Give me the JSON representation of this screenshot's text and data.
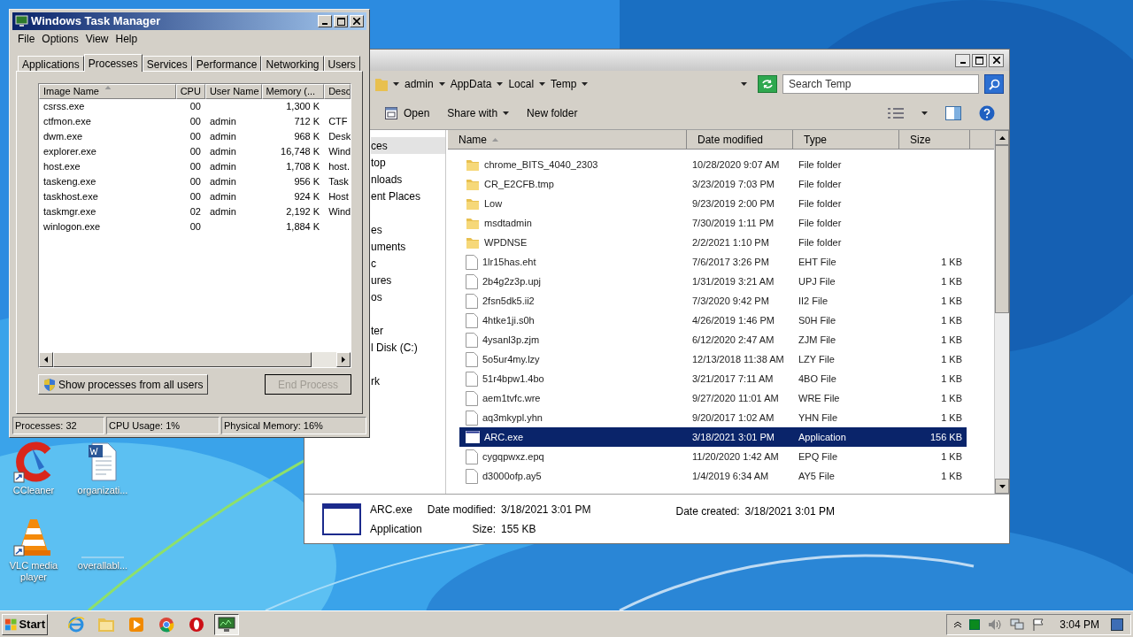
{
  "desktop": {
    "icons": [
      {
        "label": "CCleaner",
        "kind": "ccleaner"
      },
      {
        "label": "organizati...",
        "kind": "word"
      },
      {
        "label": "VLC media player",
        "kind": "vlc"
      },
      {
        "label": "overallabl...",
        "kind": "blank"
      }
    ]
  },
  "task_manager": {
    "title": "Windows Task Manager",
    "menu": [
      "File",
      "Options",
      "View",
      "Help"
    ],
    "tabs": [
      {
        "label": "Applications",
        "selected": false
      },
      {
        "label": "Processes",
        "selected": true
      },
      {
        "label": "Services",
        "selected": false
      },
      {
        "label": "Performance",
        "selected": false
      },
      {
        "label": "Networking",
        "selected": false
      },
      {
        "label": "Users",
        "selected": false
      }
    ],
    "columns": [
      {
        "label": "Image Name",
        "sorted": true
      },
      {
        "label": "CPU",
        "sorted": false
      },
      {
        "label": "User Name",
        "sorted": false
      },
      {
        "label": "Memory (...",
        "sorted": false
      },
      {
        "label": "Desc",
        "sorted": false
      }
    ],
    "rows": [
      {
        "name": "csrss.exe",
        "cpu": "00",
        "memory": "1,300 K"
      },
      {
        "name": "ctfmon.exe",
        "cpu": "00",
        "user": "admin",
        "memory": "712 K",
        "desc": "CTF"
      },
      {
        "name": "dwm.exe",
        "cpu": "00",
        "user": "admin",
        "memory": "968 K",
        "desc": "Desk"
      },
      {
        "name": "explorer.exe",
        "cpu": "00",
        "user": "admin",
        "memory": "16,748 K",
        "desc": "Wind"
      },
      {
        "name": "host.exe",
        "cpu": "00",
        "user": "admin",
        "memory": "1,708 K",
        "desc": "host."
      },
      {
        "name": "taskeng.exe",
        "cpu": "00",
        "user": "admin",
        "memory": "956 K",
        "desc": "Task"
      },
      {
        "name": "taskhost.exe",
        "cpu": "00",
        "user": "admin",
        "memory": "924 K",
        "desc": "Host"
      },
      {
        "name": "taskmgr.exe",
        "cpu": "02",
        "user": "admin",
        "memory": "2,192 K",
        "desc": "Wind"
      },
      {
        "name": "winlogon.exe",
        "cpu": "00",
        "memory": "1,884 K"
      }
    ],
    "show_all_button": {
      "label": "Show processes from all users"
    },
    "end_button": {
      "label": "End Process",
      "disabled": true
    },
    "status": [
      "Processes: 32",
      "CPU Usage: 1%",
      "Physical Memory: 16%"
    ]
  },
  "explorer": {
    "breadcrumb": [
      "admin",
      "AppData",
      "Local",
      "Temp"
    ],
    "search": {
      "placeholder": "Search Temp"
    },
    "toolbar": [
      {
        "label": "Open",
        "kind": "icon"
      },
      {
        "label": "Share with",
        "kind": "menu"
      },
      {
        "label": "New folder",
        "kind": "plain"
      }
    ],
    "nav_groups": [
      {
        "items": [
          {
            "label": "ces",
            "selected": true
          },
          {
            "label": "top",
            "selected": false
          },
          {
            "label": "nloads",
            "selected": false
          },
          {
            "label": "ent Places",
            "selected": false
          }
        ]
      },
      {
        "items": [
          {
            "label": "es",
            "selected": false
          },
          {
            "label": "uments",
            "selected": false
          },
          {
            "label": "c",
            "selected": false
          },
          {
            "label": "ures",
            "selected": false
          },
          {
            "label": "os",
            "selected": false
          }
        ]
      },
      {
        "items": [
          {
            "label": "ter",
            "selected": false
          },
          {
            "label": "l Disk (C:)",
            "selected": false
          }
        ]
      },
      {
        "items": [
          {
            "label": "rk",
            "selected": false
          }
        ]
      }
    ],
    "columns": [
      {
        "label": "Name",
        "sorted": true
      },
      {
        "label": "Date modified",
        "sorted": false
      },
      {
        "label": "Type",
        "sorted": false
      },
      {
        "label": "Size",
        "sorted": false
      }
    ],
    "files": [
      {
        "name": "chrome_BITS_4040_2303",
        "date": "10/28/2020 9:07 AM",
        "type": "File folder",
        "kind": "folder",
        "selected": false
      },
      {
        "name": "CR_E2CFB.tmp",
        "date": "3/23/2019 7:03 PM",
        "type": "File folder",
        "kind": "folder",
        "selected": false
      },
      {
        "name": "Low",
        "date": "9/23/2019 2:00 PM",
        "type": "File folder",
        "kind": "folder",
        "selected": false
      },
      {
        "name": "msdtadmin",
        "date": "7/30/2019 1:11 PM",
        "type": "File folder",
        "kind": "folder",
        "selected": false
      },
      {
        "name": "WPDNSE",
        "date": "2/2/2021 1:10 PM",
        "type": "File folder",
        "kind": "folder",
        "selected": false
      },
      {
        "name": "1lr15has.eht",
        "date": "7/6/2017 3:26 PM",
        "type": "EHT File",
        "size": "1 KB",
        "kind": "file",
        "selected": false
      },
      {
        "name": "2b4g2z3p.upj",
        "date": "1/31/2019 3:21 AM",
        "type": "UPJ File",
        "size": "1 KB",
        "kind": "file",
        "selected": false
      },
      {
        "name": "2fsn5dk5.ii2",
        "date": "7/3/2020 9:42 PM",
        "type": "II2 File",
        "size": "1 KB",
        "kind": "file",
        "selected": false
      },
      {
        "name": "4htke1ji.s0h",
        "date": "4/26/2019 1:46 PM",
        "type": "S0H File",
        "size": "1 KB",
        "kind": "file",
        "selected": false
      },
      {
        "name": "4ysanl3p.zjm",
        "date": "6/12/2020 2:47 AM",
        "type": "ZJM File",
        "size": "1 KB",
        "kind": "file",
        "selected": false
      },
      {
        "name": "5o5ur4my.lzy",
        "date": "12/13/2018 11:38 AM",
        "type": "LZY File",
        "size": "1 KB",
        "kind": "file",
        "selected": false
      },
      {
        "name": "51r4bpw1.4bo",
        "date": "3/21/2017 7:11 AM",
        "type": "4BO File",
        "size": "1 KB",
        "kind": "file",
        "selected": false
      },
      {
        "name": "aem1tvfc.wre",
        "date": "9/27/2020 11:01 AM",
        "type": "WRE File",
        "size": "1 KB",
        "kind": "file",
        "selected": false
      },
      {
        "name": "aq3mkypl.yhn",
        "date": "9/20/2017 1:02 AM",
        "type": "YHN File",
        "size": "1 KB",
        "kind": "file",
        "selected": false
      },
      {
        "name": "ARC.exe",
        "date": "3/18/2021 3:01 PM",
        "type": "Application",
        "size": "156 KB",
        "kind": "app",
        "selected": true
      },
      {
        "name": "cygqpwxz.epq",
        "date": "11/20/2020 1:42 AM",
        "type": "EPQ File",
        "size": "1 KB",
        "kind": "file",
        "selected": false
      },
      {
        "name": "d3000ofp.ay5",
        "date": "1/4/2019 6:34 AM",
        "type": "AY5 File",
        "size": "1 KB",
        "kind": "file",
        "selected": false
      }
    ],
    "details": {
      "name": "ARC.exe",
      "type": "Application",
      "fields": [
        {
          "label": "Date modified:",
          "value": "3/18/2021 3:01 PM"
        },
        {
          "label": "Size:",
          "value": "155 KB"
        },
        {
          "label": "Date created:",
          "value": "3/18/2021 3:01 PM"
        }
      ]
    }
  },
  "taskbar": {
    "start": "Start",
    "apps": [
      {
        "kind": "ie",
        "active": false
      },
      {
        "kind": "explorer",
        "active": false
      },
      {
        "kind": "media",
        "active": false
      },
      {
        "kind": "chrome",
        "active": false
      },
      {
        "kind": "opera",
        "active": false
      },
      {
        "kind": "taskmgr",
        "active": true
      }
    ],
    "clock": "3:04 PM"
  }
}
